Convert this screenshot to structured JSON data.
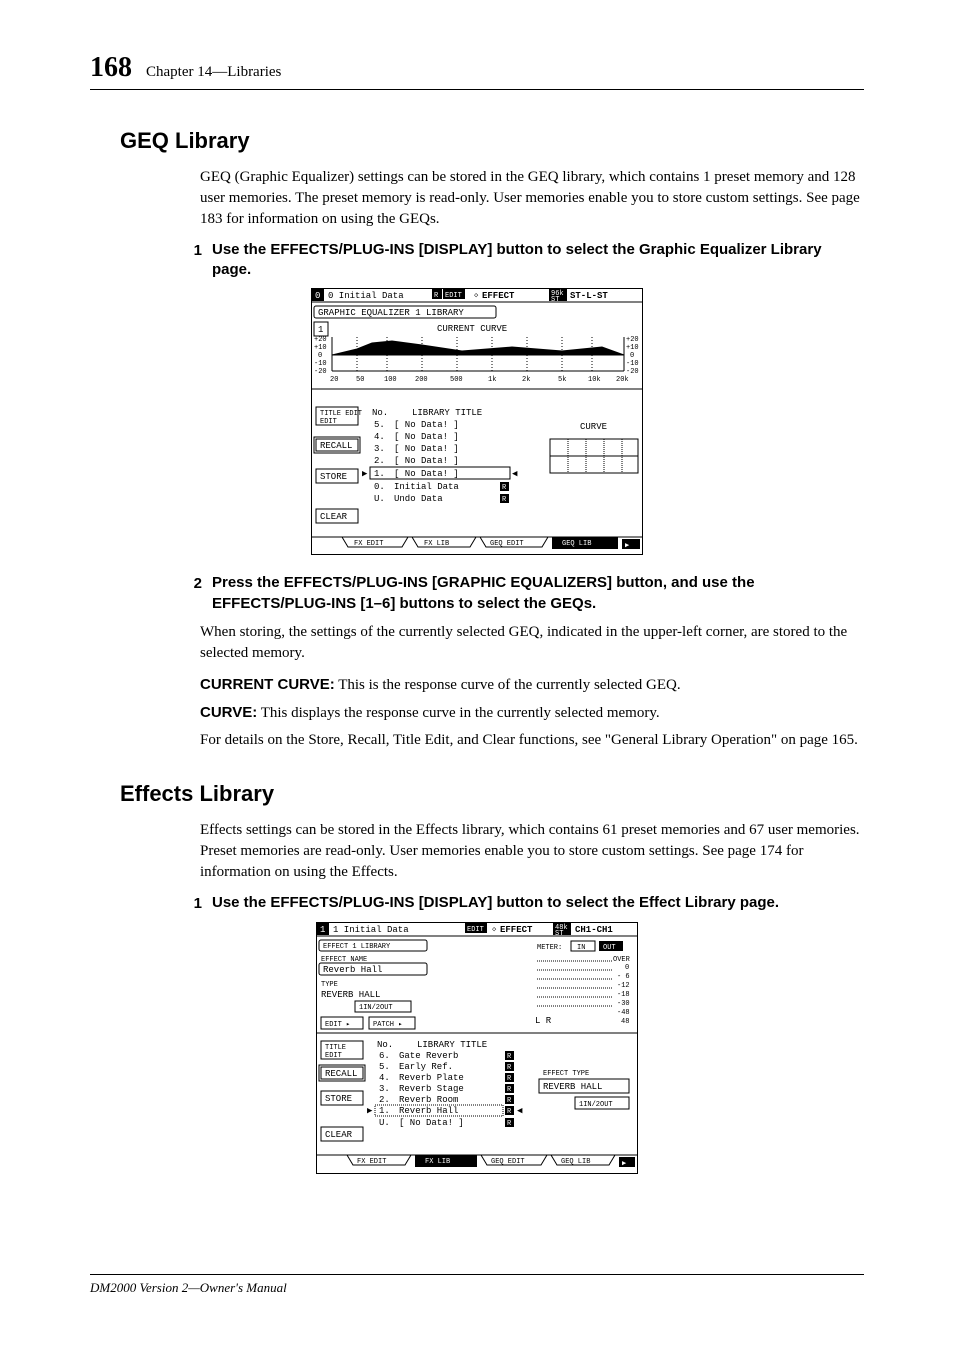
{
  "page_number": "168",
  "chapter_header": "Chapter 14—Libraries",
  "footer": "DM2000 Version 2—Owner's Manual",
  "geq": {
    "title": "GEQ Library",
    "intro": "GEQ (Graphic Equalizer) settings can be stored in the GEQ library, which contains 1 preset memory and 128 user memories. The preset memory is read-only. User memories enable you to store custom settings. See page 183 for information on using the GEQs.",
    "step1_num": "1",
    "step1": "Use the EFFECTS/PLUG-INS [DISPLAY] button to select the Graphic Equalizer Library page.",
    "step2_num": "2",
    "step2": "Press the EFFECTS/PLUG-INS [GRAPHIC EQUALIZERS] button, and use the EFFECTS/PLUG-INS [1–6] buttons to select the GEQs.",
    "step2_body": "When storing, the settings of the currently selected GEQ, indicated in the upper-left corner, are stored to the selected memory.",
    "def1_term": "CURRENT CURVE:",
    "def1_body": " This is the response curve of the currently selected GEQ.",
    "def2_term": "CURVE:",
    "def2_body": " This displays the response curve in the currently selected memory.",
    "closing": "For details on the Store, Recall, Title Edit, and Clear functions, see \"General Library Operation\" on page 165.",
    "lcd": {
      "header_left": "0 Initial Data",
      "header_badge": "EDIT",
      "header_center": "EFFECT",
      "header_rate": "96k",
      "header_right": "ST-L-ST",
      "page_label": "GRAPHIC EQUALIZER 1 LIBRARY",
      "current_curve": "CURRENT CURVE",
      "num_label": "1",
      "y_ticks": [
        "+20",
        "+10",
        "0",
        "-10",
        "-20"
      ],
      "x_ticks": [
        "20",
        "50",
        "100",
        "200",
        "500",
        "1k",
        "2k",
        "5k",
        "10k",
        "20k"
      ],
      "btn_title_edit": "TITLE EDIT",
      "btn_recall": "RECALL",
      "btn_store": "STORE",
      "btn_clear": "CLEAR",
      "list_header_no": "No.",
      "list_header_title": "LIBRARY TITLE",
      "list": [
        {
          "no": "5.",
          "title": "[ No Data! ]",
          "flag": ""
        },
        {
          "no": "4.",
          "title": "[ No Data! ]",
          "flag": ""
        },
        {
          "no": "3.",
          "title": "[ No Data! ]",
          "flag": ""
        },
        {
          "no": "2.",
          "title": "[ No Data! ]",
          "flag": ""
        },
        {
          "no": "1.",
          "title": "[ No Data! ]",
          "flag": ""
        },
        {
          "no": "0.",
          "title": "Initial Data",
          "flag": "R"
        },
        {
          "no": "U.",
          "title": "  Undo Data",
          "flag": "R"
        }
      ],
      "curve_label": "CURVE",
      "tabs": [
        "FX EDIT",
        "FX LIB",
        "GEQ EDIT",
        "GEQ LIB"
      ]
    }
  },
  "fx": {
    "title": "Effects Library",
    "intro": "Effects settings can be stored in the Effects library, which contains 61 preset memories and 67 user memories. Preset memories are read-only. User memories enable you to store custom settings. See page 174 for information on using the Effects.",
    "step1_num": "1",
    "step1": "Use the EFFECTS/PLUG-INS [DISPLAY] button to select the Effect Library page.",
    "lcd": {
      "header_left": "1 Initial Data",
      "header_badge": "EDIT",
      "header_center": "EFFECT",
      "header_rate": "48k",
      "header_right": "CH1-CH1",
      "page_label": "EFFECT 1 LIBRARY",
      "fx_name_label": "EFFECT NAME",
      "fx_name": "Reverb Hall",
      "type_label": "TYPE",
      "type": "REVERB HALL",
      "io": "1IN/2OUT",
      "btn_edit": "EDIT",
      "btn_patch": "PATCH",
      "meter_label": "METER:",
      "meter_in": "IN",
      "meter_out": "OUT",
      "meter_scale": [
        "OVER",
        "0",
        "- 6",
        "-12",
        "-18",
        "-30",
        "-48",
        "48"
      ],
      "meter_lr": "L R",
      "btn_title_edit": "TITLE EDIT",
      "btn_recall": "RECALL",
      "btn_store": "STORE",
      "btn_clear": "CLEAR",
      "list_header_no": "No.",
      "list_header_title": "LIBRARY TITLE",
      "list": [
        {
          "no": "6.",
          "title": "Gate Reverb",
          "flag": "R"
        },
        {
          "no": "5.",
          "title": "Early Ref.",
          "flag": "R"
        },
        {
          "no": "4.",
          "title": "Reverb Plate",
          "flag": "R"
        },
        {
          "no": "3.",
          "title": "Reverb Stage",
          "flag": "R"
        },
        {
          "no": "2.",
          "title": "Reverb Room",
          "flag": "R"
        },
        {
          "no": "1.",
          "title": "Reverb Hall",
          "flag": "R"
        },
        {
          "no": "U.",
          "title": "[ No Data! ]",
          "flag": "R"
        }
      ],
      "fx_type_label": "EFFECT TYPE",
      "fx_type_box": "REVERB HALL",
      "fx_type_io": "1IN/2OUT",
      "tabs": [
        "FX EDIT",
        "FX LIB",
        "GEQ EDIT",
        "GEQ LIB"
      ]
    }
  }
}
